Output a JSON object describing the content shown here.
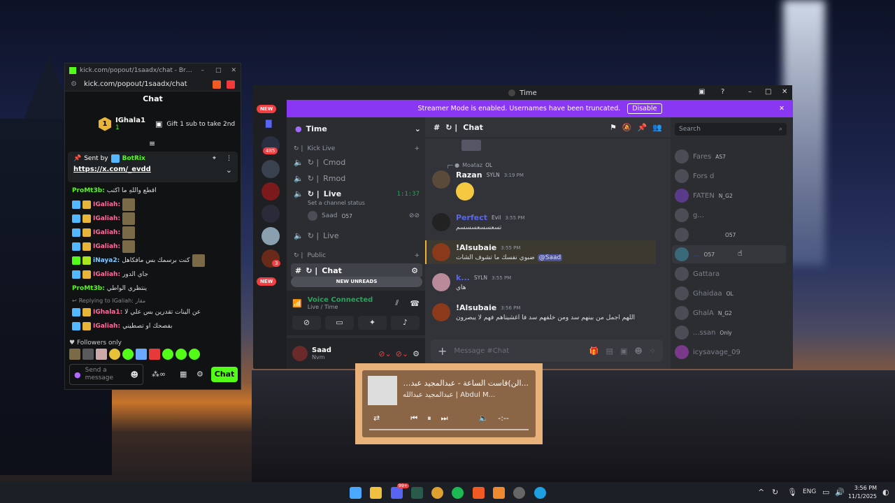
{
  "kick": {
    "title": "kick.com/popout/1saadx/chat - Brave",
    "url": "kick.com/popout/1saadx/chat",
    "chat_title": "Chat",
    "top_gifter": "IGhala1",
    "top_gifter_rank": "1",
    "top_gifter_count": "1",
    "gift_text": "Gift 1 sub to take 2nd",
    "pinned_label": "Sent by",
    "pinned_user": "BotRix",
    "pinned_link": "https://x.com/_evdd",
    "messages": [
      {
        "user": "ProMt3b:",
        "text": "اقطع واللهِ ما اكتب",
        "color": "green"
      },
      {
        "user": "IGaliah:",
        "text": "",
        "color": "pink"
      },
      {
        "user": "IGaliah:",
        "text": "",
        "color": "pink"
      },
      {
        "user": "IGaliah:",
        "text": "",
        "color": "pink"
      },
      {
        "user": "IGaliah:",
        "text": "",
        "color": "pink"
      },
      {
        "user": "iNaya2:",
        "text": "كنت برسمك بس مافكاهل",
        "color": "blue"
      },
      {
        "user": "IGaliah:",
        "text": "جاي الدور",
        "color": "pink"
      },
      {
        "user": "ProMt3b:",
        "text": "ينتظري الواطي",
        "color": "green"
      },
      {
        "user": "IGhala1:",
        "text": "عن الينات تقدرين بس علي لا",
        "color": "pink"
      },
      {
        "user": "IGaliah:",
        "text": "بفصحك او تصطيني",
        "color": "pink"
      }
    ],
    "replying_to": "Replying to IGaliah: مقار",
    "followers_only": "Followers only",
    "input_placeholder": "Send a message",
    "chat_button": "Chat"
  },
  "discord": {
    "window_title": "Time",
    "banner_text": "Streamer Mode is enabled. Usernames have been truncated.",
    "banner_button": "Disable",
    "server_name": "Time",
    "category_kick_live": "Kick Live",
    "channels": [
      "Cmod",
      "Rmod",
      "Live"
    ],
    "live_timer": "1:1:37",
    "live_status": "Set a channel status",
    "voice_user": "Saad",
    "voice_user_tag": "O57",
    "channel_live2": "Live",
    "category_public": "Public",
    "channel_chat": "Chat",
    "new_unreads": "NEW UNREADS",
    "new_badge": "NEW",
    "server_badge": "485",
    "server_badge2": "3",
    "voice_connected": "Voice Connected",
    "voice_channel": "Live / Time",
    "me_name": "Saad",
    "me_status": "Nvm",
    "header_channel": "Chat",
    "search_placeholder": "Search",
    "messages": [
      {
        "reply": "Moataz",
        "reply_tag": "OL",
        "name": "Razan",
        "tag": "SYLN",
        "time": "3:19 PM",
        "text": ""
      },
      {
        "name": "Perfect",
        "tag": "Evil",
        "time": "3:55 PM",
        "text": "تسعسسعسسسم"
      },
      {
        "name": "!Alsubaie",
        "time": "3:55 PM",
        "text": "ضبوي نفسك ما تشوف الشات",
        "mention": "@Saad"
      },
      {
        "name": "k...",
        "tag": "SYLN",
        "time": "3:55 PM",
        "text": "هاي"
      },
      {
        "name": "!Alsubaie",
        "time": "3:56 PM",
        "text": "اللهم اجمل من بينهم سد ومن خلفهم سد فا اغشيناهم فهم لا يبصرون"
      }
    ],
    "composer_placeholder": "Message #Chat",
    "members": [
      {
        "name": "Fares",
        "tag": "AS7"
      },
      {
        "name": "Fors d",
        "tag": ""
      },
      {
        "name": "FATEN",
        "tag": "N_G2"
      },
      {
        "name": "g...",
        "tag": ""
      },
      {
        "name": "",
        "tag": "O57"
      },
      {
        "name": "...",
        "tag": "O57"
      },
      {
        "name": "Gattara",
        "tag": ""
      },
      {
        "name": "Ghaidaa",
        "tag": "OL"
      },
      {
        "name": "GhalA",
        "tag": "N_G2"
      },
      {
        "name": "...ssan",
        "tag": "Only"
      },
      {
        "name": "icysavage_09",
        "tag": ""
      }
    ]
  },
  "music": {
    "title": "...الن)قاست الساعة - عبدالمجيد عبدالله",
    "artist": "عبدالمجيد عبدالله | Abdul M...",
    "time": "-:--"
  },
  "taskbar": {
    "lang": "ENG",
    "time": "3:56 PM",
    "date": "11/1/2025",
    "discord_badge": "99+"
  },
  "colors": {
    "kick_green": "#53fc18",
    "discord_bg": "#313338",
    "banner": "#8a37f4"
  }
}
